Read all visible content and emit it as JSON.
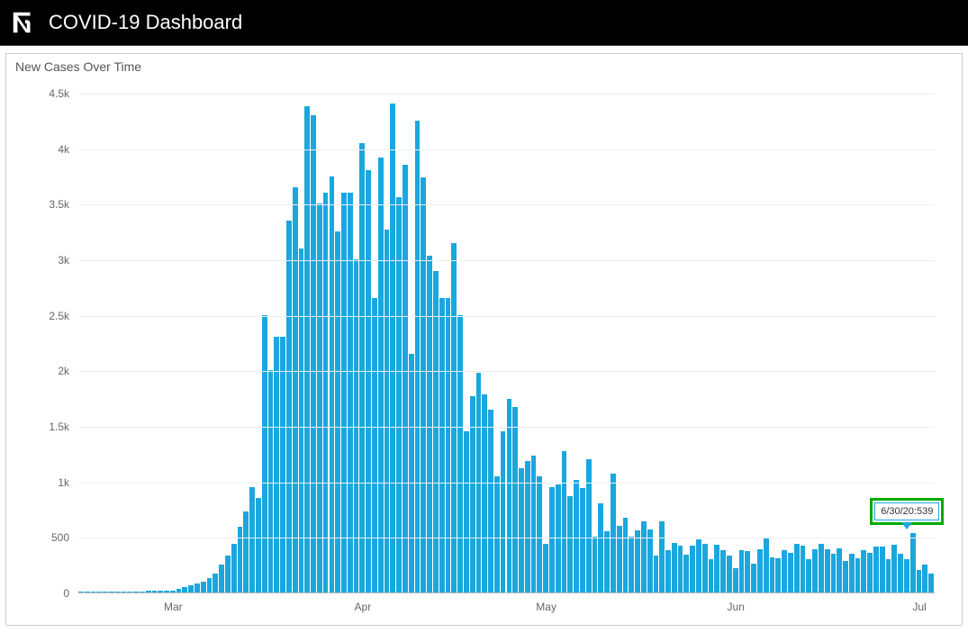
{
  "header": {
    "title": "COVID-19 Dashboard"
  },
  "card": {
    "title": "New Cases Over Time"
  },
  "tooltip": {
    "text": "6/30/20:539"
  },
  "colors": {
    "bar": "#1aa7de",
    "grid": "#eeeeee",
    "callout_border": "#00aa00"
  },
  "chart_data": {
    "type": "bar",
    "title": "New Cases Over Time",
    "xlabel": "",
    "ylabel": "",
    "ylim": [
      0,
      4500
    ],
    "y_ticks": [
      0,
      500,
      1000,
      1500,
      2000,
      2500,
      3000,
      3500,
      4000,
      4500
    ],
    "y_tick_labels": [
      "0",
      "500",
      "1k",
      "1.5k",
      "2k",
      "2.5k",
      "3k",
      "3.5k",
      "4k",
      "4.5k"
    ],
    "x_tick_labels": [
      "Mar",
      "Apr",
      "May",
      "Jun",
      "Jul"
    ],
    "x_tick_positions": [
      15,
      46,
      76,
      107,
      137
    ],
    "tooltip_index": 136,
    "categories_start": "2020-02-15",
    "values": [
      5,
      5,
      5,
      5,
      5,
      5,
      5,
      8,
      10,
      10,
      12,
      15,
      15,
      18,
      20,
      20,
      30,
      45,
      65,
      80,
      95,
      130,
      170,
      250,
      330,
      440,
      590,
      730,
      950,
      850,
      2500,
      2000,
      2300,
      2300,
      3350,
      3650,
      3100,
      4380,
      4300,
      3500,
      3600,
      3750,
      3250,
      3600,
      3600,
      3000,
      4050,
      3800,
      2650,
      3920,
      3270,
      4400,
      3560,
      3850,
      2150,
      4250,
      3740,
      3030,
      2895,
      2650,
      2650,
      3150,
      2500,
      1450,
      1770,
      1980,
      1780,
      1650,
      1050,
      1450,
      1740,
      1670,
      1120,
      1180,
      1230,
      1050,
      440,
      950,
      970,
      1270,
      870,
      1010,
      940,
      1200,
      500,
      800,
      550,
      1070,
      600,
      670,
      500,
      560,
      640,
      570,
      330,
      640,
      380,
      450,
      420,
      340,
      420,
      480,
      440,
      300,
      430,
      380,
      330,
      220,
      380,
      370,
      260,
      390,
      490,
      320,
      310,
      380,
      360,
      440,
      420,
      300,
      390,
      440,
      390,
      350,
      400,
      280,
      350,
      310,
      380,
      360,
      410,
      410,
      300,
      430,
      350,
      300,
      539,
      200,
      250,
      170
    ]
  }
}
